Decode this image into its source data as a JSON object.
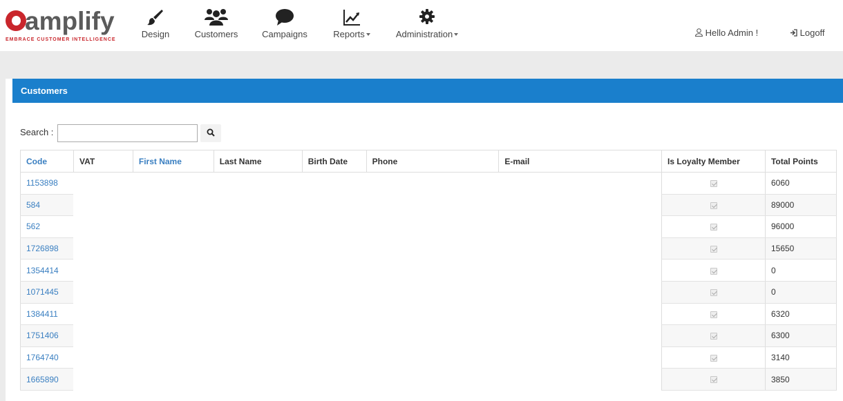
{
  "brand": {
    "name": "amplify",
    "tagline": "EMBRACE CUSTOMER INTELLIGENCE",
    "accent_color": "#c9262c"
  },
  "nav": {
    "design": {
      "label": "Design",
      "icon": "brush-icon"
    },
    "customers": {
      "label": "Customers",
      "icon": "users-icon"
    },
    "campaigns": {
      "label": "Campaigns",
      "icon": "speech-bubble-icon"
    },
    "reports": {
      "label": "Reports",
      "icon": "line-chart-icon"
    },
    "administration": {
      "label": "Administration",
      "icon": "gear-icon"
    }
  },
  "user": {
    "greeting": "Hello Admin !",
    "logoff": "Logoff"
  },
  "panel": {
    "title": "Customers",
    "header_color": "#1a7fcc"
  },
  "search": {
    "label": "Search :",
    "value": ""
  },
  "table": {
    "columns": {
      "code": "Code",
      "vat": "VAT",
      "first_name": "First Name",
      "last_name": "Last Name",
      "birth_date": "Birth Date",
      "phone": "Phone",
      "email": "E-mail",
      "is_loyalty_member": "Is Loyalty Member",
      "total_points": "Total Points"
    },
    "rows": [
      {
        "code": "1153898",
        "points": "6060"
      },
      {
        "code": "584",
        "points": "89000"
      },
      {
        "code": "562",
        "points": "96000"
      },
      {
        "code": "1726898",
        "points": "15650"
      },
      {
        "code": "1354414",
        "points": "0"
      },
      {
        "code": "1071445",
        "points": "0"
      },
      {
        "code": "1384411",
        "points": "6320"
      },
      {
        "code": "1751406",
        "points": "6300"
      },
      {
        "code": "1764740",
        "points": "3140"
      },
      {
        "code": "1665890",
        "points": "3850"
      }
    ]
  }
}
